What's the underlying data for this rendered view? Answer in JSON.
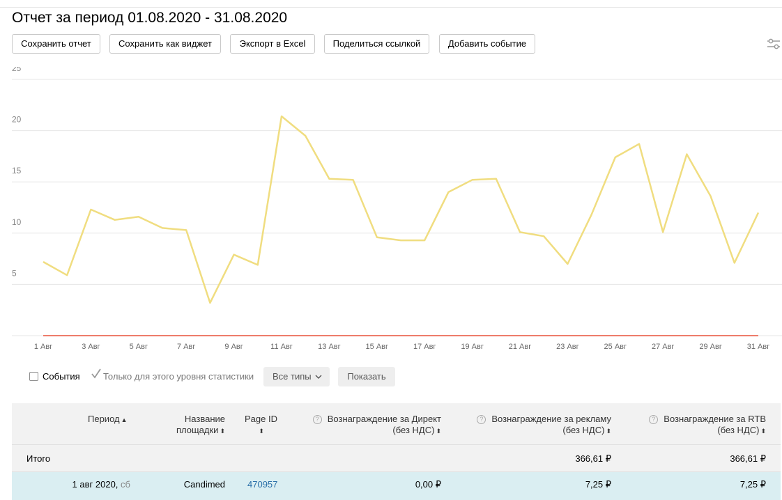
{
  "page": {
    "title": "Отчет за период 01.08.2020 - 31.08.2020"
  },
  "toolbar": {
    "save_report": "Сохранить отчет",
    "save_widget": "Сохранить как виджет",
    "export_excel": "Экспорт в Excel",
    "share_link": "Поделиться ссылкой",
    "add_event": "Добавить событие"
  },
  "icons": {
    "settings": "sliders-icon",
    "sort": "sort-arrows-icon",
    "help": "question-circle-icon"
  },
  "colors": {
    "series_main": "#f0dd80",
    "series_zero": "#e8503a",
    "grid": "#e6e6e6",
    "highlight_row": "#daeef2",
    "link": "#2a6fa8"
  },
  "chart_data": {
    "type": "line",
    "x": [
      "1 Авг",
      "2 Авг",
      "3 Авг",
      "4 Авг",
      "5 Авг",
      "6 Авг",
      "7 Авг",
      "8 Авг",
      "9 Авг",
      "10 Авг",
      "11 Авг",
      "12 Авг",
      "13 Авг",
      "14 Авг",
      "15 Авг",
      "16 Авг",
      "17 Авг",
      "18 Авг",
      "19 Авг",
      "20 Авг",
      "21 Авг",
      "22 Авг",
      "23 Авг",
      "24 Авг",
      "25 Авг",
      "26 Авг",
      "27 Авг",
      "28 Авг",
      "29 Авг",
      "30 Авг",
      "31 Авг"
    ],
    "x_ticks": [
      "1 Авг",
      "3 Авг",
      "5 Авг",
      "7 Авг",
      "9 Авг",
      "11 Авг",
      "13 Авг",
      "15 Авг",
      "17 Авг",
      "19 Авг",
      "21 Авг",
      "23 Авг",
      "25 Авг",
      "27 Авг",
      "29 Авг",
      "31 Авг"
    ],
    "y_ticks": [
      "5",
      "10",
      "15",
      "20",
      "25"
    ],
    "ylim": [
      0,
      25
    ],
    "grid": true,
    "series": [
      {
        "values": [
          7.2,
          5.9,
          12.3,
          11.3,
          11.6,
          10.5,
          10.3,
          3.2,
          7.9,
          6.9,
          21.4,
          19.5,
          15.3,
          15.2,
          9.6,
          9.3,
          9.3,
          14.0,
          15.2,
          15.3,
          10.1,
          9.7,
          7.0,
          11.8,
          17.4,
          18.7,
          10.1,
          17.7,
          13.6,
          7.1,
          12.0
        ],
        "color": "#f0dd80"
      },
      {
        "values": [
          0,
          0,
          0,
          0,
          0,
          0,
          0,
          0,
          0,
          0,
          0,
          0,
          0,
          0,
          0,
          0,
          0,
          0,
          0,
          0,
          0,
          0,
          0,
          0,
          0,
          0,
          0,
          0,
          0,
          0,
          0
        ],
        "color": "#e8503a"
      }
    ]
  },
  "filters": {
    "events_label": "События",
    "events_checked": false,
    "level_label": "Только для этого уровня статистики",
    "level_checked": true,
    "types_dropdown": "Все типы",
    "show_button": "Показать"
  },
  "table": {
    "headers": {
      "period": "Период",
      "site_name_1": "Название",
      "site_name_2": "площадки",
      "page_id": "Page ID",
      "direct_1": "Вознаграждение за Директ",
      "direct_2": "(без НДС)",
      "ads_1": "Вознаграждение за рекламу",
      "ads_2": "(без НДС)",
      "rtb_1": "Вознаграждение за RTB",
      "rtb_2": "(без НДС)"
    },
    "total": {
      "label": "Итого",
      "ads": "366,61 ₽",
      "rtb": "366,61 ₽"
    },
    "rows": [
      {
        "date": "1 авг 2020,",
        "weekday": "сб",
        "site": "Candimed",
        "page_id": "470957",
        "direct": "0,00 ₽",
        "ads": "7,25 ₽",
        "rtb": "7,25 ₽"
      }
    ]
  }
}
